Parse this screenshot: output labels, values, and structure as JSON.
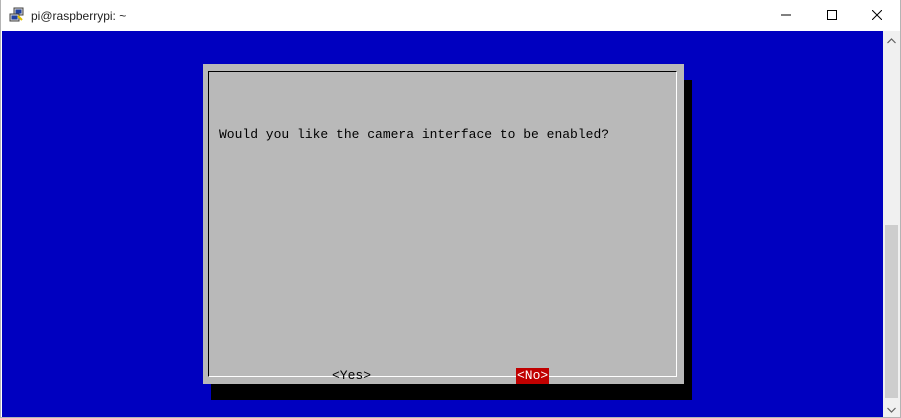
{
  "window": {
    "title": "pi@raspberrypi: ~",
    "icons": {
      "app": "putty-app-icon",
      "minimize": "minimize-icon",
      "maximize": "maximize-icon",
      "close": "close-icon"
    }
  },
  "dialog": {
    "prompt": "Would you like the camera interface to be enabled?",
    "buttons": {
      "yes": "<Yes>",
      "no": "<No>"
    },
    "selected": "no"
  },
  "colors": {
    "terminal_bg": "#0000c0",
    "dialog_bg": "#b9b9b9",
    "selected_button_bg": "#c00000"
  }
}
